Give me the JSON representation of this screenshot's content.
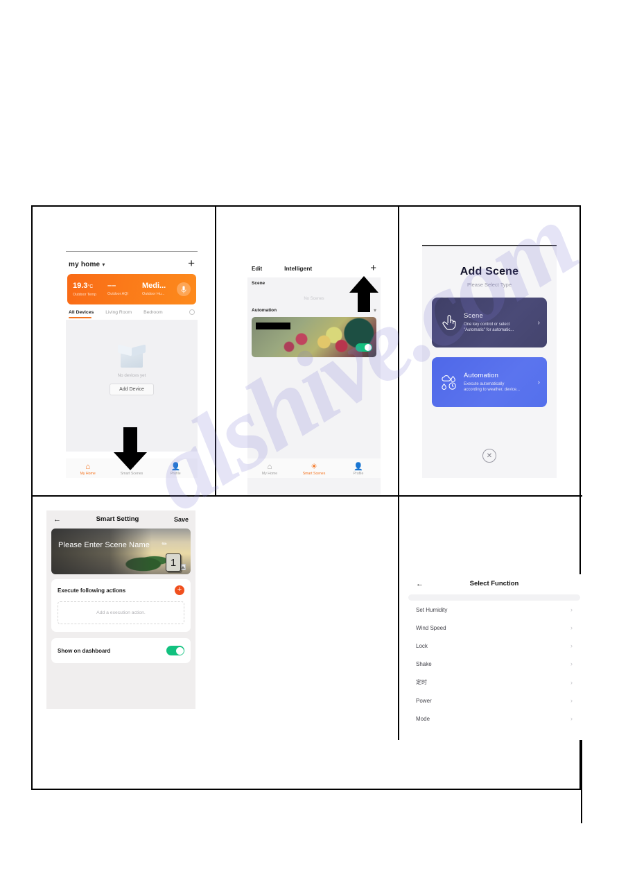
{
  "panel1": {
    "home_name": "my home",
    "add_label": "+",
    "weather": [
      {
        "value": "19.3",
        "unit": "°C",
        "label": "Outdoor Temp"
      },
      {
        "value": "––",
        "unit": "",
        "label": "Outdoor AQI"
      },
      {
        "value": "Medi...",
        "unit": "",
        "label": "Outdoor Hu..."
      }
    ],
    "tabs": [
      "All Devices",
      "Living Room",
      "Bedroom"
    ],
    "empty_text": "No devices yet",
    "add_device": "Add Device",
    "nav": [
      "My Home",
      "Smart Scenes",
      "Profile"
    ]
  },
  "panel2": {
    "edit": "Edit",
    "title": "Intelligent",
    "add_label": "+",
    "scene_section": "Scene",
    "no_scenes": "No Scenes",
    "automation_section": "Automation",
    "nav": [
      "My Home",
      "Smart Scenes",
      "Profile"
    ]
  },
  "panel3": {
    "title": "Add Scene",
    "subtitle": "Please Select Type",
    "cards": [
      {
        "name": "Scene",
        "desc": "One key control or select\n\"Automatic\" for automatic...",
        "arrow": "›"
      },
      {
        "name": "Automation",
        "desc": "Execute automatically\naccording to weather, device...",
        "arrow": "›"
      }
    ],
    "close": "✕"
  },
  "panel4": {
    "back": "←",
    "title": "Smart Setting",
    "save": "Save",
    "scene_name_placeholder": "Please Enter Scene Name",
    "actions_title": "Execute following actions",
    "add_action_placeholder": "Add a execution action.",
    "dashboard_label": "Show on dashboard",
    "callout": "1"
  },
  "panel5": {
    "back": "←",
    "title": "Select Function",
    "functions": [
      "Set Humidity",
      "Wind Speed",
      "Lock",
      "Shake",
      "定时",
      "Power",
      "Mode"
    ],
    "chevron": "›"
  },
  "watermark": "alshive.com"
}
